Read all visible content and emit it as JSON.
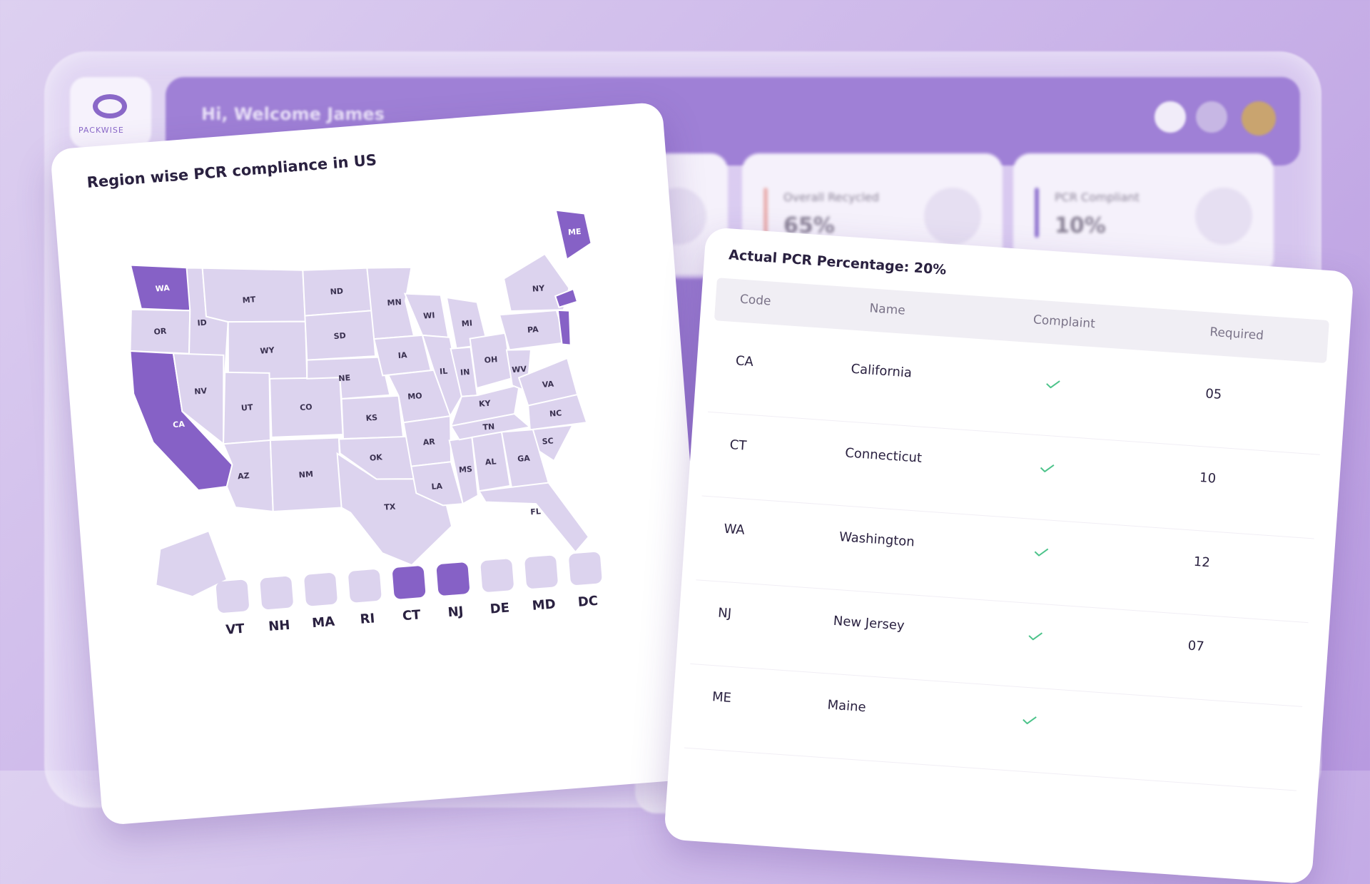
{
  "header": {
    "welcome": "Hi, Welcome James",
    "logo_text": "PACKWISE"
  },
  "stats": [
    {
      "label": "",
      "value": "",
      "color": "#8f73cf"
    },
    {
      "label": "Overall Recycled",
      "value": "65%",
      "color": "#e8a0a0"
    },
    {
      "label": "PCR Compliant",
      "value": "10%",
      "color": "#8f73cf"
    }
  ],
  "map_card": {
    "title": "Region wise PCR compliance in US",
    "state_labels": [
      "WA",
      "OR",
      "CA",
      "ID",
      "NV",
      "MT",
      "WY",
      "UT",
      "AZ",
      "CO",
      "NM",
      "ND",
      "SD",
      "NE",
      "KS",
      "OK",
      "TX",
      "MN",
      "IA",
      "MO",
      "AR",
      "LA",
      "WI",
      "IL",
      "MS",
      "MI",
      "IN",
      "KY",
      "TN",
      "AL",
      "OH",
      "WV",
      "VA",
      "NC",
      "SC",
      "GA",
      "FL",
      "PA",
      "NY",
      "ME"
    ],
    "highlighted": [
      "WA",
      "CA",
      "ME",
      "NJ",
      "CT"
    ],
    "legend": [
      {
        "code": "VT",
        "compliant": false
      },
      {
        "code": "NH",
        "compliant": false
      },
      {
        "code": "MA",
        "compliant": false
      },
      {
        "code": "RI",
        "compliant": false
      },
      {
        "code": "CT",
        "compliant": true
      },
      {
        "code": "NJ",
        "compliant": true
      },
      {
        "code": "DE",
        "compliant": false
      },
      {
        "code": "MD",
        "compliant": false
      },
      {
        "code": "DC",
        "compliant": false
      }
    ],
    "colors": {
      "compliant": "#8661c6",
      "default": "#dcd3ee",
      "border": "#ffffff"
    }
  },
  "table_card": {
    "title": "Actual PCR Percentage: 20%",
    "columns": [
      "Code",
      "Name",
      "Complaint",
      "Required"
    ],
    "rows": [
      {
        "code": "CA",
        "name": "California",
        "complaint": "check",
        "required": "05"
      },
      {
        "code": "CT",
        "name": "Connecticut",
        "complaint": "check",
        "required": "10"
      },
      {
        "code": "WA",
        "name": "Washington",
        "complaint": "check",
        "required": "12"
      },
      {
        "code": "NJ",
        "name": "New Jersey",
        "complaint": "check",
        "required": "07"
      },
      {
        "code": "ME",
        "name": "Maine",
        "complaint": "check",
        "required": ""
      }
    ],
    "check_color": "#4cc38a"
  }
}
